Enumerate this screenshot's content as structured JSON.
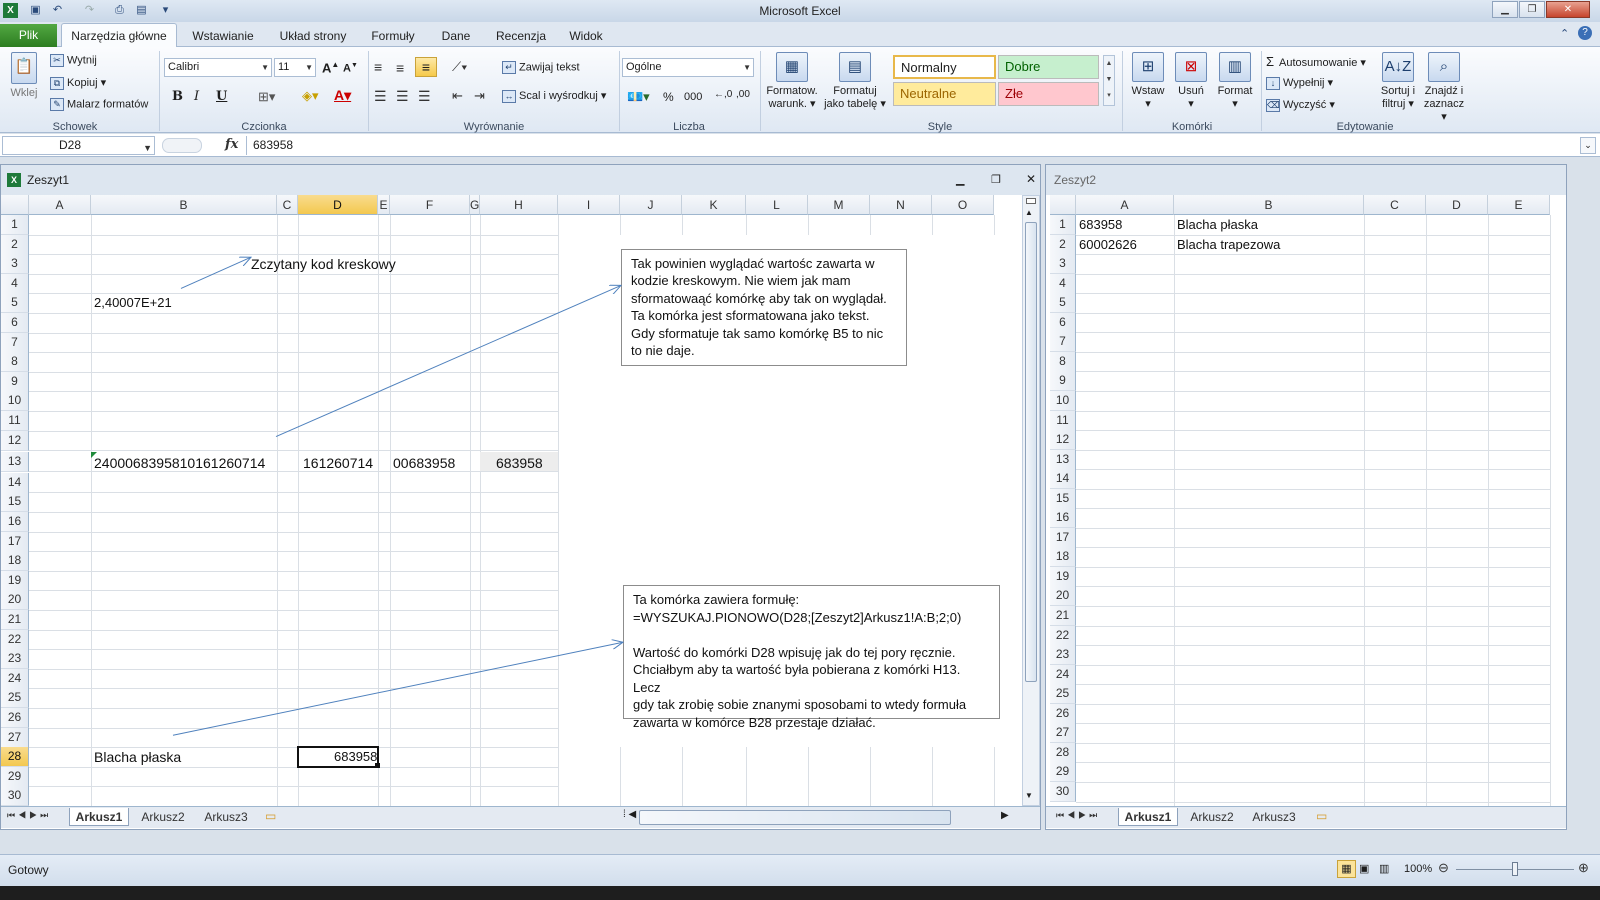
{
  "app": {
    "title": "Microsoft Excel"
  },
  "quick_access": {
    "save": "save-icon",
    "undo": "undo-icon",
    "redo": "redo-icon",
    "print": "print-preview-icon",
    "customize": "customize-icon"
  },
  "tabs": {
    "file": "Plik",
    "items": [
      "Narzędzia główne",
      "Wstawianie",
      "Układ strony",
      "Formuły",
      "Dane",
      "Recenzja",
      "Widok"
    ]
  },
  "ribbon": {
    "clipboard": {
      "paste": "Wklej",
      "cut": "Wytnij",
      "copy": "Kopiuj",
      "format_painter": "Malarz formatów",
      "group": "Schowek"
    },
    "font": {
      "name": "Calibri",
      "size": "11",
      "bold": "B",
      "italic": "I",
      "underline": "U",
      "group": "Czcionka"
    },
    "alignment": {
      "wrap": "Zawijaj tekst",
      "merge": "Scal i wyśrodkuj",
      "group": "Wyrównanie"
    },
    "number": {
      "format": "Ogólne",
      "percent": "%",
      "thousands": "000",
      "group": "Liczba"
    },
    "styles": {
      "cond_format": [
        "Formatow.",
        "warunk."
      ],
      "format_table": [
        "Formatuj",
        "jako tabelę"
      ],
      "normal": "Normalny",
      "good": "Dobre",
      "neutral": "Neutralne",
      "bad": "Złe",
      "group": "Style"
    },
    "cells": {
      "insert": "Wstaw",
      "delete": "Usuń",
      "format": "Format",
      "group": "Komórki"
    },
    "editing": {
      "autosum": "Autosumowanie",
      "fill": "Wypełnij",
      "clear": "Wyczyść",
      "sort": [
        "Sortuj i",
        "filtruj"
      ],
      "find": [
        "Znajdź i",
        "zaznacz"
      ],
      "group": "Edytowanie"
    }
  },
  "formula_bar": {
    "name_box": "D28",
    "fx": "fx",
    "content": "683958"
  },
  "wb1": {
    "title": "Zeszyt1",
    "columns": [
      "A",
      "B",
      "C",
      "D",
      "E",
      "F",
      "G",
      "H",
      "I",
      "J",
      "K",
      "L",
      "M",
      "N",
      "O"
    ],
    "rows": [
      "1",
      "2",
      "3",
      "4",
      "5",
      "6",
      "7",
      "8",
      "9",
      "10",
      "11",
      "12",
      "13",
      "14",
      "15",
      "16",
      "17",
      "18",
      "19",
      "20",
      "21",
      "22",
      "23",
      "24",
      "25",
      "26",
      "27",
      "28",
      "29",
      "30"
    ],
    "cells": {
      "a3": "Zczytany kod kreskowy",
      "b5": "2,40007E+21",
      "b13": "240006839581016126071​4",
      "d13": "161260714",
      "f13": "00683958",
      "h13": "683958",
      "b28": "Blacha płaska",
      "d28": "683958"
    },
    "note1": [
      "Tak powinien wyglądać wartośc zawarta w",
      "kodzie kreskowym. Nie wiem jak mam",
      "sformatowaąć komórkę aby tak on wyglądał.",
      "Ta komórka jest sformatowana jako tekst.",
      "Gdy sformatuje tak samo komórkę B5  to nic",
      "to nie daje."
    ],
    "note2": [
      "Ta komórka zawiera formułę:",
      "=WYSZUKAJ.PIONOWO(D28;[Zeszyt2]Arkusz1!A:B;2;0)",
      "",
      "Wartość do komórki D28 wpisuję jak do tej pory ręcznie.",
      "Chciałbym aby ta wartość była pobierana z komórki H13. Lecz",
      "gdy tak zrobię sobie znanymi sposobami to wtedy formuła",
      "zawarta w komórce B28  przestaje działać."
    ],
    "sheets": [
      "Arkusz1",
      "Arkusz2",
      "Arkusz3"
    ]
  },
  "wb2": {
    "title": "Zeszyt2",
    "columns": [
      "A",
      "B",
      "C",
      "D",
      "E"
    ],
    "rows": [
      "1",
      "2",
      "3",
      "4",
      "5",
      "6",
      "7",
      "8",
      "9",
      "10",
      "11",
      "12",
      "13",
      "14",
      "15",
      "16",
      "17",
      "18",
      "19",
      "20",
      "21",
      "22",
      "23",
      "24",
      "25",
      "26",
      "27",
      "28",
      "29",
      "30"
    ],
    "data": [
      [
        "683958",
        "Blacha płaska"
      ],
      [
        "60002626",
        "Blacha trapezowa"
      ]
    ],
    "sheets": [
      "Arkusz1",
      "Arkusz2",
      "Arkusz3"
    ]
  },
  "status": {
    "ready": "Gotowy",
    "zoom": "100%"
  }
}
